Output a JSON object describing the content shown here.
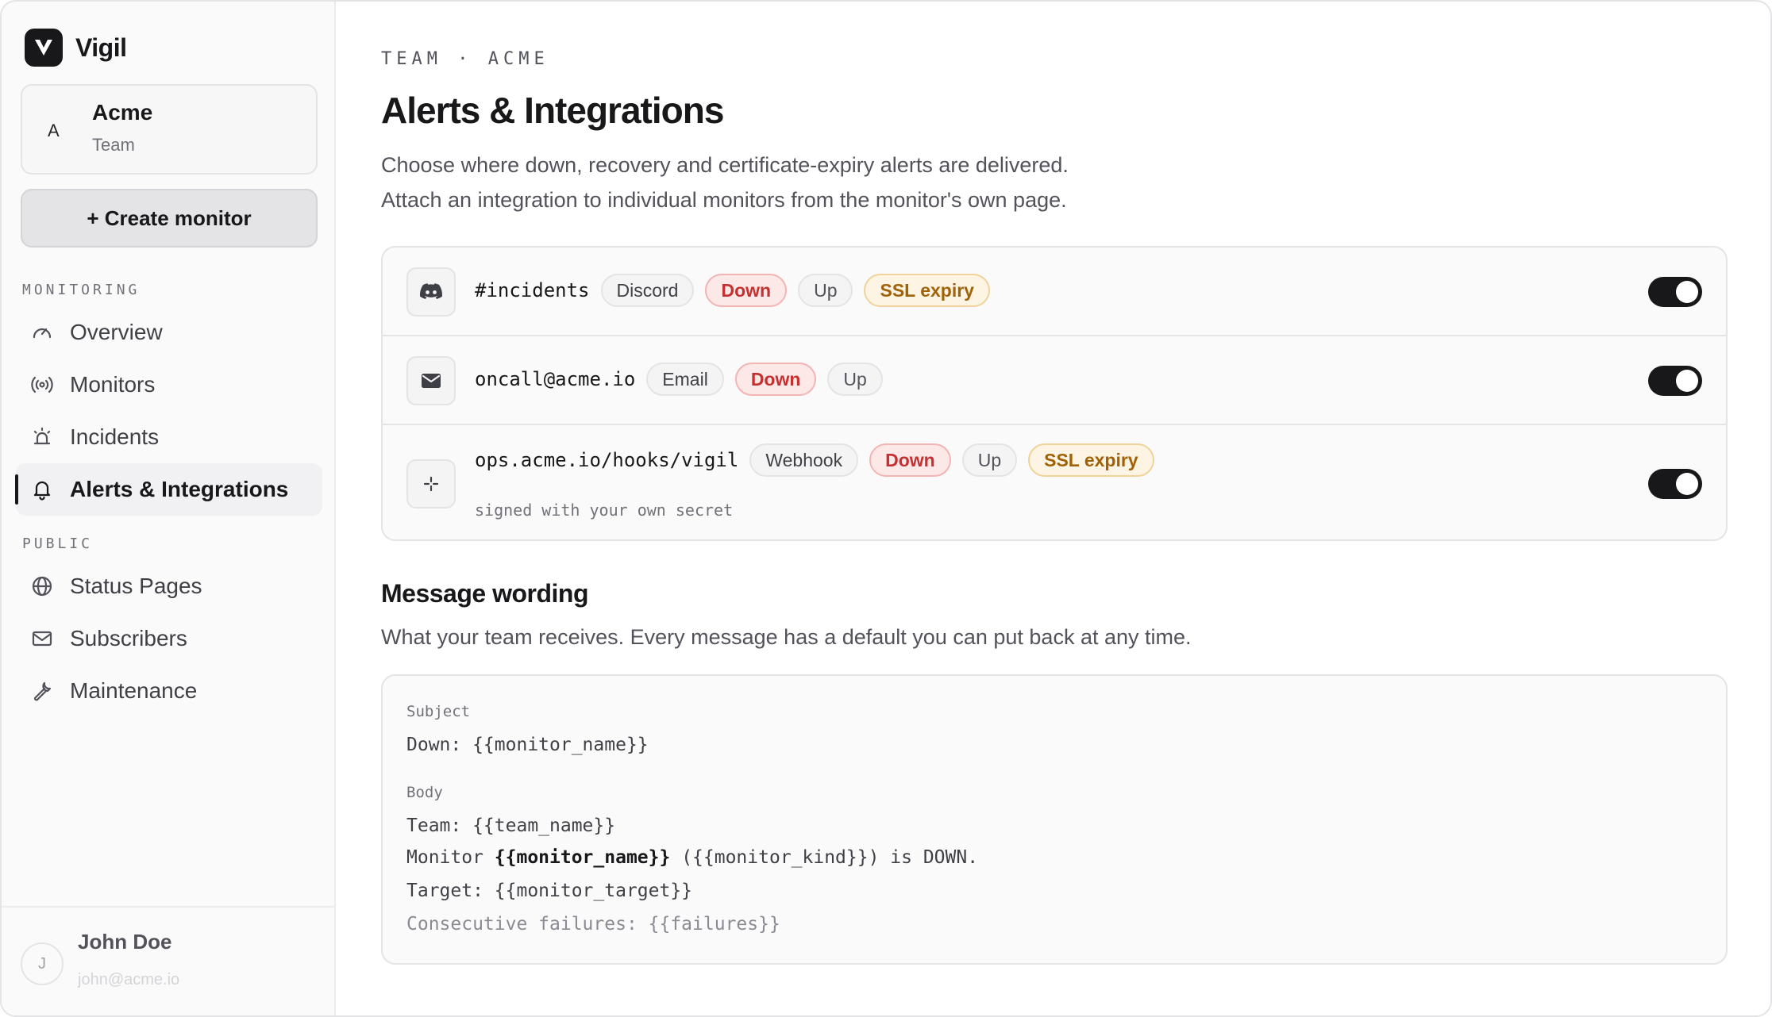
{
  "app": {
    "name": "Vigil",
    "logo_icon": "vigil-logo-icon"
  },
  "team": {
    "initial": "A",
    "name": "Acme",
    "label": "Team"
  },
  "sidebar": {
    "create_label": "+ Create monitor",
    "sections": [
      {
        "label": "MONITORING",
        "items": [
          {
            "label": "Overview",
            "icon": "gauge-icon"
          },
          {
            "label": "Monitors",
            "icon": "broadcast-icon"
          },
          {
            "label": "Incidents",
            "icon": "siren-icon"
          },
          {
            "label": "Alerts & Integrations",
            "icon": "bell-icon",
            "active": true
          }
        ]
      },
      {
        "label": "PUBLIC",
        "items": [
          {
            "label": "Status Pages",
            "icon": "globe-icon"
          },
          {
            "label": "Subscribers",
            "icon": "mail-icon"
          },
          {
            "label": "Maintenance",
            "icon": "wrench-icon"
          }
        ]
      }
    ]
  },
  "user": {
    "initial": "J",
    "name": "John Doe",
    "email": "john@acme.io"
  },
  "main": {
    "eyebrow": "TEAM · ACME",
    "title": "Alerts & Integrations",
    "desc_line1": "Choose where down, recovery and certificate-expiry alerts are delivered.",
    "desc_line2": "Attach an integration to individual monitors from the monitor's own page."
  },
  "integrations": [
    {
      "target": "#incidents",
      "type": "Discord",
      "events": [
        "Down",
        "Up",
        "SSL expiry"
      ],
      "icon": "discord-icon",
      "enabled": true
    },
    {
      "target": "oncall@acme.io",
      "type": "Email",
      "events": [
        "Down",
        "Up"
      ],
      "icon": "envelope-icon",
      "enabled": true
    },
    {
      "target": "ops.acme.io/hooks/vigil",
      "type": "Webhook",
      "events": [
        "Down",
        "Up",
        "SSL expiry"
      ],
      "icon": "webhook-icon",
      "note": "signed with your own secret",
      "enabled": true
    }
  ],
  "message": {
    "title": "Message wording",
    "desc": "What your team receives. Every message has a default you can put back at any time.",
    "subject_label": "Subject",
    "subject": "Down: {{monitor_name}}",
    "body_label": "Body",
    "body_line1": "Team: {{team_name}}",
    "body_line2_prefix": "Monitor ",
    "body_line2_bold": "{{monitor_name}}",
    "body_line2_suffix": " ({{monitor_kind}}) is DOWN.",
    "body_line3": "Target: {{monitor_target}}",
    "body_line4": "Consecutive failures: {{failures}}"
  }
}
